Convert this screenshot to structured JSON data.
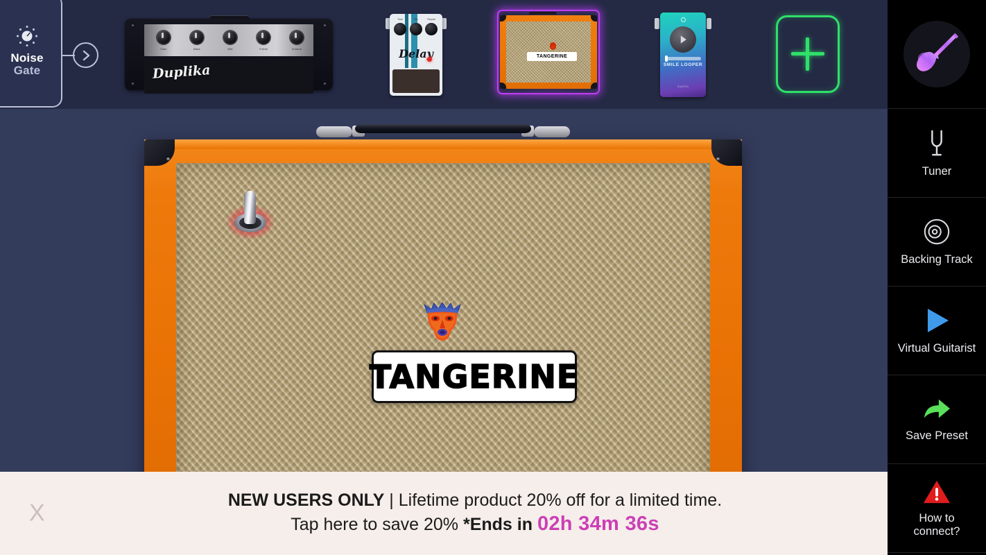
{
  "app": {
    "background_color": "#343c5c",
    "chainbar_color": "#242a44",
    "sidebar_color": "#000000",
    "accent_orange": "#ef7a0a",
    "accent_green": "#2fe06a",
    "accent_purple": "#c13bf0",
    "accent_pink": "#cc3fb6"
  },
  "chain": {
    "noise_gate": {
      "line1": "Noise",
      "line2": "Gate",
      "icon": "noise-gate-knob-icon",
      "arrow_icon": "chevron-right-circle-icon"
    },
    "slots": [
      {
        "id": "amp-head",
        "type": "amp-head",
        "name": "Duplika",
        "logo": "Duplika",
        "selected": false,
        "knobs": [
          "Gain",
          "Bass",
          "Mid",
          "Treble",
          "Volume"
        ]
      },
      {
        "id": "delay-pedal",
        "type": "pedal",
        "name": "Delay",
        "label": "Delay",
        "selected": false,
        "knobs": [
          "Time",
          "Mix",
          "Repeat"
        ],
        "led_color": "#e02a2a"
      },
      {
        "id": "tangerine-amp",
        "type": "cabinet",
        "name": "TANGERINE",
        "badge": "TANGERINE",
        "selected": true
      },
      {
        "id": "smile-looper",
        "type": "pedal",
        "name": "SMILE LOOPER",
        "label": "SMILE LOOPER",
        "brand": "duplika",
        "selected": false
      },
      {
        "id": "add-slot",
        "type": "add",
        "name": "Add effect",
        "glyph": "+",
        "selected": false
      }
    ]
  },
  "main_amp": {
    "name": "TANGERINE",
    "badge_text": "TANGERINE",
    "emblem": "tangerine-crown-face-emblem",
    "power_switch": {
      "name": "power-toggle-switch",
      "state": "on",
      "glow_color": "#e13c46"
    },
    "cabinet_color": "#ef7a0a",
    "grill_color": "#bda87a"
  },
  "sidebar": {
    "logo": {
      "name": "guitar-logo",
      "icon": "electric-guitar-icon"
    },
    "items": [
      {
        "label": "Tuner",
        "icon": "tuning-fork-icon",
        "color": "#d8d8de"
      },
      {
        "label": "Backing Track",
        "icon": "vinyl-disc-icon",
        "color": "#d8d8de"
      },
      {
        "label": "Virtual Guitarist",
        "icon": "play-triangle-icon",
        "color": "#3f9aea"
      },
      {
        "label": "Save Preset",
        "icon": "share-arrow-icon",
        "color": "#5ae05a"
      },
      {
        "label": "How to\nconnect?",
        "icon": "warning-triangle-icon",
        "color": "#e01c1c"
      }
    ]
  },
  "banner": {
    "close_label": "X",
    "headline_bold": "NEW USERS ONLY",
    "headline_sep": " | ",
    "headline_rest": "Lifetime product 20% off for a limited time.",
    "line2_prefix": "Tap here to save 20% ",
    "line2_bold": "*Ends in ",
    "timer": "02h 34m 36s"
  }
}
